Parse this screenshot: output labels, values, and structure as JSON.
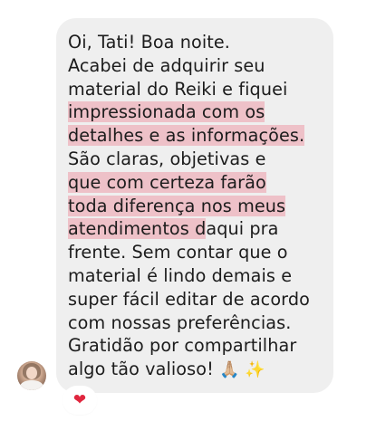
{
  "message": {
    "lines": [
      [
        {
          "text": "Oi, Tati! Boa noite."
        }
      ],
      [
        {
          "text": "Acabei de adquirir seu"
        }
      ],
      [
        {
          "text": "material do Reiki e fiquei"
        }
      ],
      [
        {
          "text": "impressionada com os",
          "hl": true
        }
      ],
      [
        {
          "text": "detalhes e as informações.",
          "hl": true
        }
      ],
      [
        {
          "text": "São claras, objetivas e"
        }
      ],
      [
        {
          "text": "que com certeza farão",
          "hl": true
        }
      ],
      [
        {
          "text": "toda diferença nos meus",
          "hl": true
        }
      ],
      [
        {
          "text": "atendimentos d",
          "hl": true
        },
        {
          "text": "aqui pra"
        }
      ],
      [
        {
          "text": "frente. Sem contar que o"
        }
      ],
      [
        {
          "text": "material é lindo demais e"
        }
      ],
      [
        {
          "text": "super fácil editar de acordo"
        }
      ],
      [
        {
          "text": "com nossas preferências."
        }
      ],
      [
        {
          "text": "Gratidão por compartilhar"
        }
      ],
      [
        {
          "text": "algo tão valioso! "
        },
        {
          "text": "🙏🏼 ✨",
          "emoji": true
        }
      ]
    ]
  },
  "reaction": {
    "emoji": "❤",
    "icon": "heart-icon",
    "color": "#e0263e"
  },
  "colors": {
    "bubble": "#efefef",
    "highlight": "#ec9aa8",
    "text": "#1c1c1c"
  }
}
